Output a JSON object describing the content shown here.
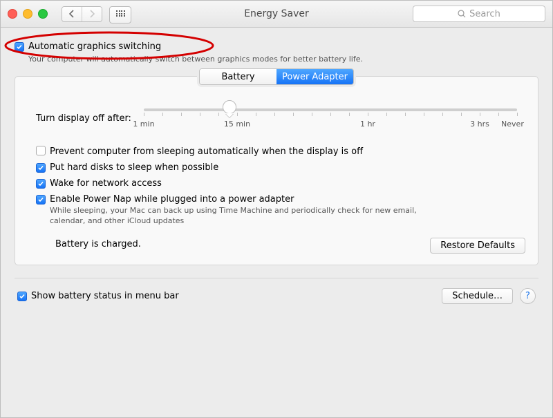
{
  "window": {
    "title": "Energy Saver",
    "search_placeholder": "Search"
  },
  "top_option": {
    "label": "Automatic graphics switching",
    "checked": true,
    "description": "Your computer will automatically switch between graphics modes for better battery life."
  },
  "tabs": [
    {
      "label": "Battery",
      "active": false
    },
    {
      "label": "Power Adapter",
      "active": true
    }
  ],
  "slider": {
    "label": "Turn display off after:",
    "ticks": [
      "1 min",
      "15 min",
      "1 hr",
      "3 hrs",
      "Never"
    ]
  },
  "options": [
    {
      "label": "Prevent computer from sleeping automatically when the display is off",
      "checked": false
    },
    {
      "label": "Put hard disks to sleep when possible",
      "checked": true
    },
    {
      "label": "Wake for network access",
      "checked": true
    },
    {
      "label": "Enable Power Nap while plugged into a power adapter",
      "checked": true,
      "sub": "While sleeping, your Mac can back up using Time Machine and periodically check for new email, calendar, and other iCloud updates"
    }
  ],
  "battery_status": "Battery is charged.",
  "buttons": {
    "restore": "Restore Defaults",
    "schedule": "Schedule…"
  },
  "footer_option": {
    "label": "Show battery status in menu bar",
    "checked": true
  },
  "annotation": {
    "type": "ellipse-highlight",
    "target": "automatic-graphics-switching-checkbox",
    "color": "#d40000"
  }
}
